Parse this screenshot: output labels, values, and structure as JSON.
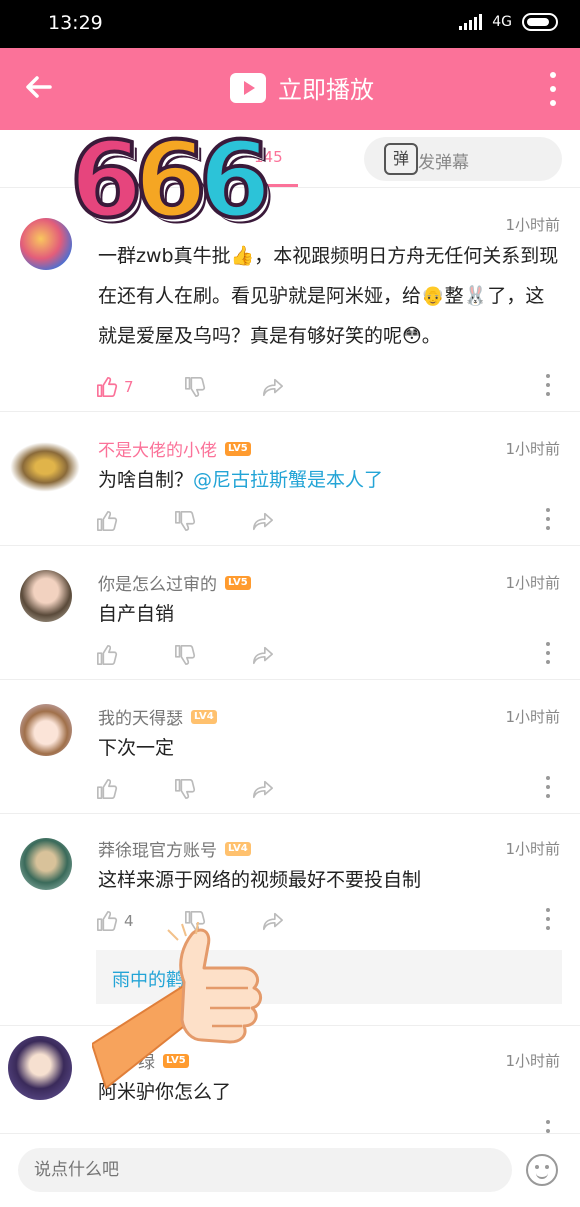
{
  "status": {
    "time": "13:29",
    "network": "4G"
  },
  "header": {
    "play_label": "立即播放"
  },
  "tabs": {
    "comment_count": "145"
  },
  "danmaku": {
    "placeholder": "点我发弹幕",
    "icon_label": "弹"
  },
  "sticker": {
    "digits": [
      "6",
      "6",
      "6"
    ]
  },
  "comments": [
    {
      "username": "",
      "level": "",
      "time": "1小时前",
      "text": "一群zwb真牛批👍，本视跟频明日方舟无任何关系到现在还有人在刷。看见驴就是阿米娅，给👴整🐰了，这就是爱屋及乌吗？真是有够好笑的呢😳。",
      "likes": "7",
      "liked": true
    },
    {
      "username": "不是大佬的小佬",
      "level": "LV5",
      "time": "1小时前",
      "text": "为啥自制？",
      "mention": "@尼古拉斯蟹是本人了",
      "likes": ""
    },
    {
      "username": "你是怎么过审的",
      "level": "LV5",
      "time": "1小时前",
      "text": "自产自销",
      "likes": ""
    },
    {
      "username": "我的天得瑟",
      "level": "LV4",
      "time": "1小时前",
      "text": "下次一定",
      "likes": ""
    },
    {
      "username": "莽徐琨官方账号",
      "level": "LV4",
      "time": "1小时前",
      "text": "这样来源于网络的视频最好不要投自制",
      "likes": "4",
      "reply_user": "雨中的鹳",
      "reply_rest": "同"
    },
    {
      "username": "绿",
      "level": "LV5",
      "time": "1小时前",
      "text": "阿米驴你怎么了",
      "likes": ""
    }
  ],
  "composer": {
    "placeholder": "说点什么吧"
  },
  "colors": {
    "accent": "#fb7299",
    "link": "#23a4d6",
    "level": "#ff9b2f"
  }
}
